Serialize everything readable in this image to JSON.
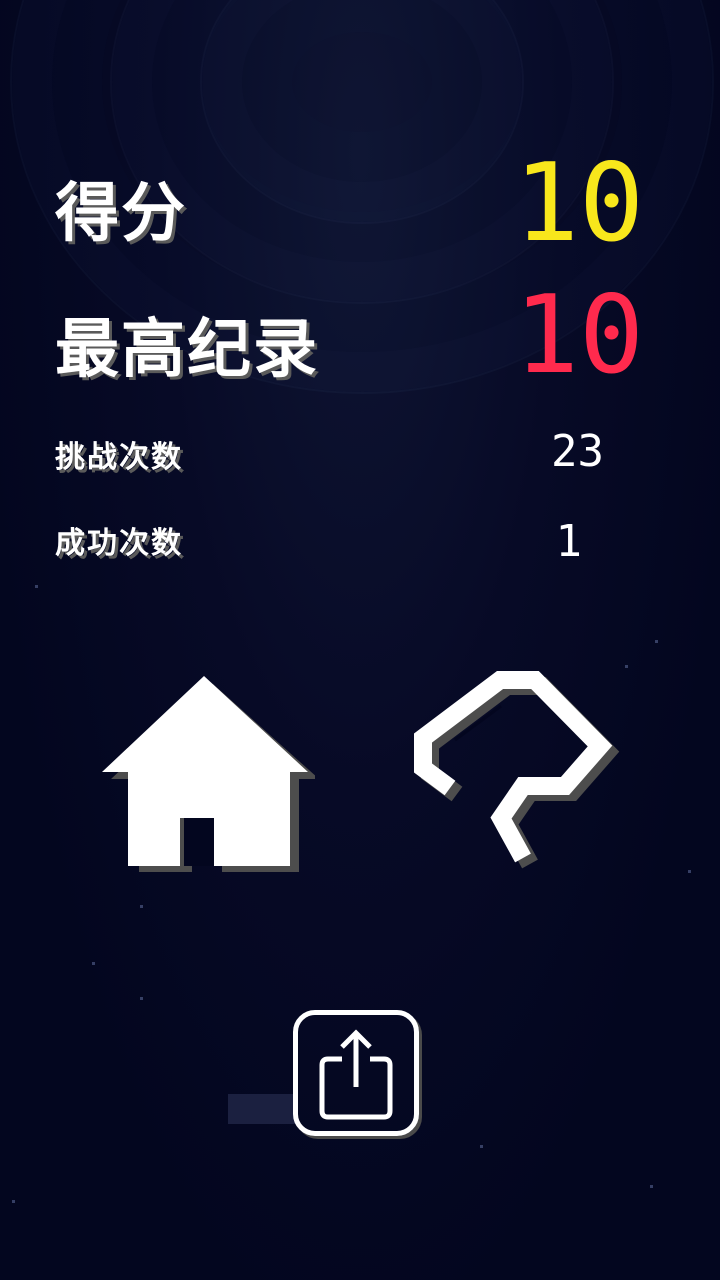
{
  "stats": {
    "score_label": "得分",
    "score_value": "10",
    "best_label": "最高纪录",
    "best_value": "10",
    "challenge_label": "挑战次数",
    "challenge_value": "23",
    "success_label": "成功次数",
    "success_value": "1"
  },
  "colors": {
    "score": "#f8e71c",
    "best": "#ff2a4d",
    "text": "#ffffff"
  },
  "icons": {
    "home": "home-icon",
    "restart": "restart-icon",
    "share": "share-icon"
  }
}
